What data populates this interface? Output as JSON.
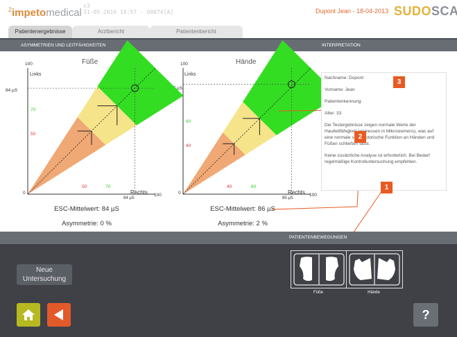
{
  "header": {
    "logo_sup": "2",
    "logo_brand": "impeto",
    "logo_suffix": "medical",
    "version_line1": "v3",
    "version_line2": "31-05-2016 18:57 - 00074[A]",
    "patient": "Dupont Jean - 18-04-2013",
    "brand_a": "SUDO",
    "brand_b": "SCAN"
  },
  "tabs": [
    {
      "label": "Patientenergebnisse",
      "active": true
    },
    {
      "label": "Arztbericht",
      "active": false
    },
    {
      "label": "Patientenbericht",
      "active": false
    }
  ],
  "sections": {
    "left": "ASYMMETRIEN UND LEITFÄHIGKEITEN",
    "right": "INTERPRETATION",
    "movement": "PATIENTENBEWEGUNGEN"
  },
  "chart_data": [
    {
      "type": "scatter",
      "title": "Füße",
      "xlabel": "Rechts",
      "ylabel": "Links",
      "xlim": [
        0,
        100
      ],
      "ylim": [
        0,
        100
      ],
      "axis_max_x_label": "100",
      "axis_max_y_label": "100",
      "axis_zero_label": "0",
      "zones": {
        "low": 50,
        "mid": 70
      },
      "x_ticks": [
        "50",
        "70"
      ],
      "y_ticks": [
        "70",
        "50"
      ],
      "point": {
        "x": 84,
        "y": 84
      },
      "point_x_label": "84 µS",
      "point_y_label": "84 µS",
      "esc_label": "ESC-Mittelwert: 84 µS",
      "asym_label": "Asymmetrie: 0 %"
    },
    {
      "type": "scatter",
      "title": "Hände",
      "xlabel": "Rechts",
      "ylabel": "Links",
      "xlim": [
        0,
        100
      ],
      "ylim": [
        0,
        100
      ],
      "axis_max_x_label": "100",
      "axis_max_y_label": "100",
      "axis_zero_label": "0",
      "zones": {
        "low": 40,
        "mid": 60
      },
      "x_ticks": [
        "40",
        "60"
      ],
      "y_ticks": [
        "60",
        "40"
      ],
      "point": {
        "x": 85,
        "y": 87
      },
      "point_x_label": "85 µS",
      "point_y_label": "87 µS",
      "esc_label": "ESC-Mittelwert: 86 µS",
      "asym_label": "Asymmetrie: 2 %"
    }
  ],
  "interpretation": {
    "name": "Nachname: Dupont",
    "firstname": "Vorname: Jean",
    "id": "Patientenkennung:",
    "age": "Alter: 33",
    "text1": "Die Testergebnisse zeigen normale Werte der Hautleitfähigkeit (gemessen in Mikrosiemens), was auf eine normale sudomotorische Funktion an Händen und Füßen schließen lässt.",
    "text2": "Keine zusätzliche Analyse ist erforderlich. Bei Bedarf regelmäßige Kontrolluntersuchung empfehlen."
  },
  "markers": [
    "1",
    "2",
    "3"
  ],
  "movement": {
    "feet_label": "Füße",
    "hands_label": "Hände"
  },
  "buttons": {
    "new_exam": "Neue Untersuchung",
    "help": "?"
  },
  "colors": {
    "green": "#33dd22",
    "light_green": "#aef08a",
    "yellow": "#f5e48a",
    "orange": "#f0a874",
    "red": "#d33",
    "accent": "#e85a22"
  }
}
